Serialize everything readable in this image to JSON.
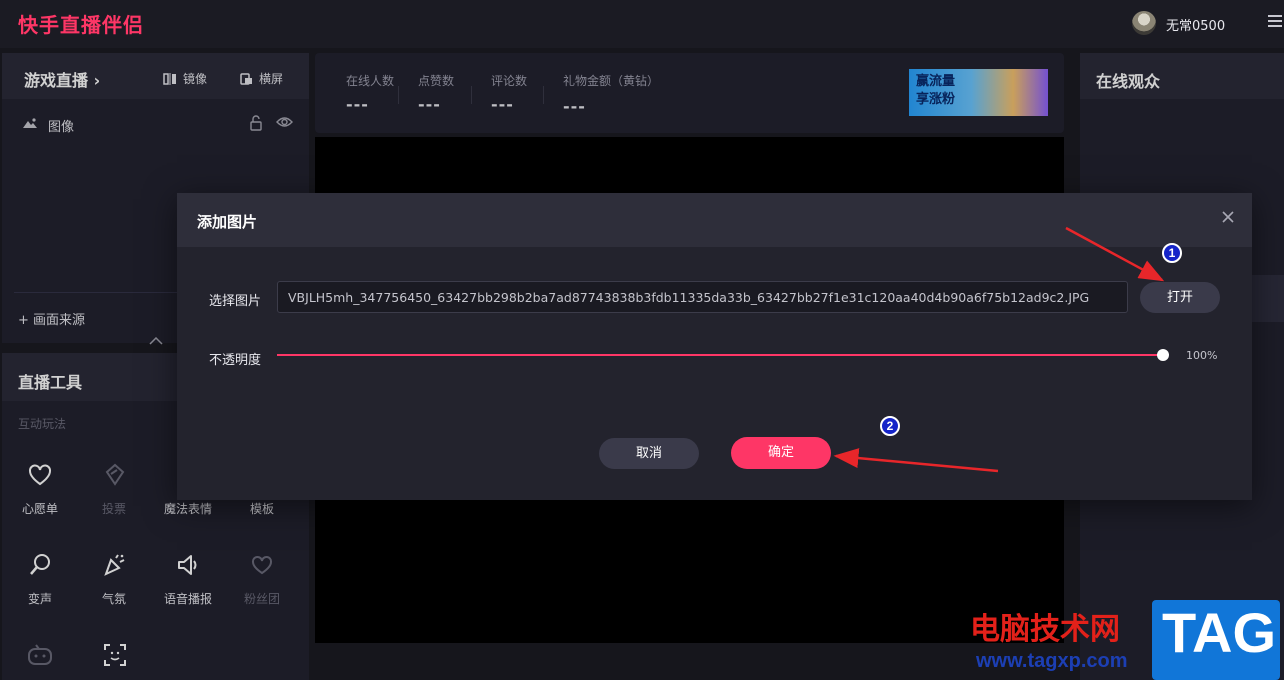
{
  "app": {
    "title": "快手直播伴侣"
  },
  "user": {
    "name": "无常0500"
  },
  "scene_panel": {
    "title": "游戏直播 ›",
    "mirror_label": "镜像",
    "landscape_label": "横屏",
    "items": [
      {
        "label": "图像"
      }
    ],
    "add_source_label": "+ 画面来源"
  },
  "tools_panel": {
    "title": "直播工具",
    "subtitle": "互动玩法",
    "items": [
      {
        "label": "心愿单",
        "icon": "heart-bubble-icon"
      },
      {
        "label": "投票",
        "icon": "ticket-icon"
      },
      {
        "label": "魔法表情",
        "icon": "magic-face-icon"
      },
      {
        "label": "模板",
        "icon": "template-icon"
      },
      {
        "label": "变声",
        "icon": "voice-change-icon"
      },
      {
        "label": "气氛",
        "icon": "party-popper-icon"
      },
      {
        "label": "语音播报",
        "icon": "speaker-icon"
      },
      {
        "label": "粉丝团",
        "icon": "fan-club-icon"
      }
    ]
  },
  "stats": [
    {
      "label": "在线人数",
      "value": "---"
    },
    {
      "label": "点赞数",
      "value": "---"
    },
    {
      "label": "评论数",
      "value": "---"
    },
    {
      "label": "礼物金额（黄钻）",
      "value": "---"
    }
  ],
  "banner": {
    "line1": "赢流量",
    "line2": "享涨粉"
  },
  "viewers_panel": {
    "title": "在线观众"
  },
  "dialog": {
    "title": "添加图片",
    "select_label": "选择图片",
    "file_value": "VBJLH5mh_347756450_63427bb298b2ba7ad87743838b3fdb11335da33b_63427bb27f1e31c120aa40d4b90a6f75b12ad9c2.JPG",
    "open_label": "打开",
    "opacity_label": "不透明度",
    "opacity_value": "100%",
    "opacity_fraction": 1.0,
    "cancel_label": "取消",
    "confirm_label": "确定"
  },
  "annotations": {
    "marker1": "1",
    "marker2": "2",
    "arrow_color": "#e8262a"
  },
  "watermark": {
    "name": "电脑技术网",
    "url": "www.tagxp.com",
    "logo": "TAG"
  },
  "colors": {
    "accent": "#fe3666",
    "panel": "#232330",
    "background": "#1b1b23"
  }
}
